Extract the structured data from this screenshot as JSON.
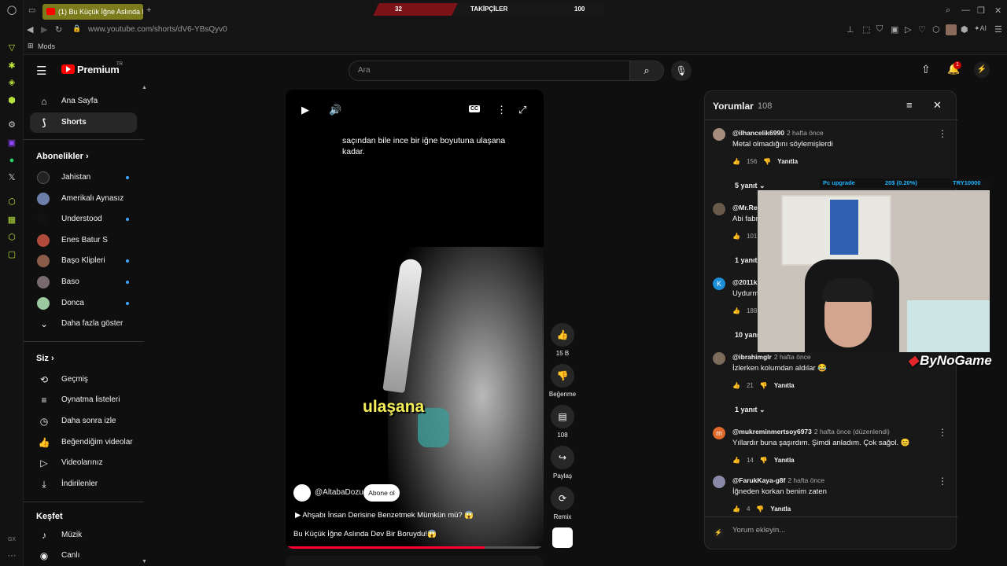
{
  "browser": {
    "tab_title": "(1) Bu Küçük İğne Aslında D",
    "url": "www.youtube.com/shorts/dV6-YBsQyv0",
    "bookmark": "Mods"
  },
  "stream_overlay": {
    "left_count": "32",
    "label": "TAKİPÇİLER",
    "right_count": "100",
    "cam_items": [
      "Pc upgrade",
      "20$ (0.20%)",
      "TRY10000"
    ],
    "brand": "ByNoGame"
  },
  "youtube": {
    "logo": "Premium",
    "region": "TR",
    "search_placeholder": "Ara",
    "notification_count": "1"
  },
  "sidebar": {
    "main": [
      {
        "label": "Ana Sayfa",
        "icon": "home-icon"
      },
      {
        "label": "Shorts",
        "icon": "shorts-icon"
      }
    ],
    "subs_title": "Abonelikler",
    "subs": [
      {
        "label": "Jahistan",
        "color": "#222222",
        "dot": true
      },
      {
        "label": "Amerikalı Aynasız",
        "color": "#6d7fa8",
        "dot": false
      },
      {
        "label": "Understood",
        "color": "#111111",
        "dot": true
      },
      {
        "label": "Enes Batur S",
        "color": "#b04a3a",
        "dot": false
      },
      {
        "label": "Başo Klipleri",
        "color": "#8a5c4a",
        "dot": true
      },
      {
        "label": "Baso",
        "color": "#7a6a70",
        "dot": true
      },
      {
        "label": "Donca",
        "color": "#9cc9a0",
        "dot": true
      }
    ],
    "show_more": "Daha fazla göster",
    "you_title": "Siz",
    "you": [
      {
        "label": "Geçmiş",
        "icon": "history-icon"
      },
      {
        "label": "Oynatma listeleri",
        "icon": "playlist-icon"
      },
      {
        "label": "Daha sonra izle",
        "icon": "clock-icon"
      },
      {
        "label": "Beğendiğim videolar",
        "icon": "like-icon"
      },
      {
        "label": "Videolarınız",
        "icon": "video-icon"
      },
      {
        "label": "İndirilenler",
        "icon": "download-icon"
      }
    ],
    "explore_title": "Keşfet",
    "explore": [
      {
        "label": "Müzik",
        "icon": "music-icon"
      },
      {
        "label": "Canlı",
        "icon": "live-icon"
      }
    ]
  },
  "video": {
    "caption_top": "saçından bile ince bir iğne boyutuna ulaşana kadar.",
    "caption_big": "ulaşana",
    "channel": "@AltabaDozu",
    "subscribe": "Abone ol",
    "sound": "Ahşabı İnsan Derisine Benzetmek Mümkün mü? 😱",
    "title": "Bu Küçük İğne Aslında Dev Bir Boruydu!😱",
    "progress": 0.77
  },
  "actions": {
    "likes": "15 B",
    "dislike": "Beğenme",
    "comments": "108",
    "share": "Paylaş",
    "remix": "Remix"
  },
  "comments": {
    "title": "Yorumlar",
    "count": "108",
    "add_placeholder": "Yorum ekleyin...",
    "reply_label": "Yanıtla",
    "items": [
      {
        "user": "@ilhancelik6990",
        "time": "2 hafta önce",
        "text": "Metal olmadığını söylemişlerdi",
        "likes": "156",
        "replies": "5 yanıt",
        "color": "#a58c7c"
      },
      {
        "user": "@Mr.Rec",
        "time": "",
        "text": "Abi fabr",
        "likes": "101",
        "replies": "1 yanıt",
        "color": "#6a5a4a"
      },
      {
        "user": "@2011k",
        "time": "",
        "text": "Uydurma",
        "likes": "188",
        "replies": "10 yanıt",
        "color": "#1c8ed8"
      },
      {
        "user": "@ibrahimglr",
        "time": "2 hafta önce",
        "text": "İzlerken kolumdan aldılar 😂",
        "likes": "21",
        "replies": "1 yanıt",
        "color": "#7c6c5c"
      },
      {
        "user": "@mukreminmertsoy6973",
        "time": "2 hafta önce (düzenlendi)",
        "text": "Yıllardır buna şaşırdım. Şimdi anladım. Çok sağol. 😊",
        "likes": "14",
        "replies": "",
        "color": "#e06a2c"
      },
      {
        "user": "@FarukKaya-g8f",
        "time": "2 hafta önce",
        "text": "İğneden korkan benim zaten",
        "likes": "4",
        "replies": "",
        "color": "#8a8aa8"
      }
    ]
  }
}
